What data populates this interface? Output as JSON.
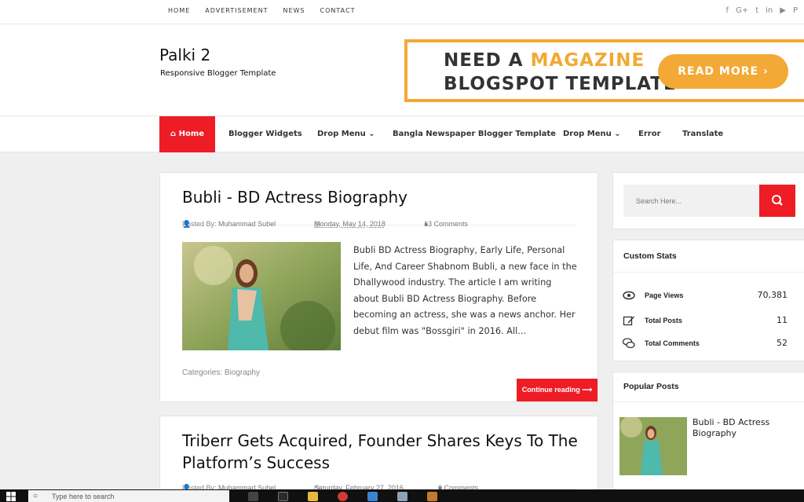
{
  "topnav": [
    "HOME",
    "ADVERTISEMENT",
    "NEWS",
    "CONTACT"
  ],
  "social_icons": [
    "facebook-icon",
    "google-plus-icon",
    "twitter-icon",
    "linkedin-icon",
    "youtube-icon",
    "pinterest-icon"
  ],
  "social_glyphs": [
    "f",
    "G+",
    "t",
    "in",
    "▶",
    "P"
  ],
  "site": {
    "title": "Palki 2",
    "description": "Responsive Blogger Template"
  },
  "banner": {
    "line1_a": "NEED A ",
    "line1_b": "MAGAZINE",
    "line2": "BLOGSPOT TEMPLATE",
    "button": "READ MORE ›"
  },
  "mainnav": [
    "Home",
    "Blogger Widgets",
    "Drop Menu",
    "Bangla Newspaper Blogger Template",
    "Drop Menu",
    "Error",
    "Translate"
  ],
  "posts": [
    {
      "title": "Bubli - BD Actress Biography",
      "author_label": "Posted By:",
      "author": "Muhammad Subel",
      "date": "Monday, May 14, 2018",
      "comments": "13 Comments",
      "excerpt": "Bubli BD Actress Biography, Early Life, Personal Life, And Career Shabnom Bubli, a new face in the Dhallywood industry. The article I am writing about Bubli BD Actress Biography. Before becoming an actress, she was a news anchor. Her debut film was \"Bossgiri\" in 2016. All...",
      "categories_label": "Categories:",
      "category": "Biography",
      "read_more": "Continue reading ⟶"
    },
    {
      "title_line1": "Triberr Gets Acquired, Founder Shares Keys To The",
      "title_line2": "Platform’s Success",
      "author_label": "Posted By:",
      "author": "Muhammad Subel",
      "date": "Saturday, February 27, 2016",
      "comments": "0 Comments"
    }
  ],
  "search": {
    "placeholder": "Search Here..."
  },
  "stats": {
    "title": "Custom Stats",
    "rows": [
      {
        "label": "Page Views",
        "value": "70,381",
        "icon": "eye-icon"
      },
      {
        "label": "Total Posts",
        "value": "11",
        "icon": "edit-icon"
      },
      {
        "label": "Total Comments",
        "value": "52",
        "icon": "comments-icon"
      }
    ]
  },
  "popular": {
    "title": "Popular Posts",
    "items": [
      {
        "title": "Bubli - BD Actress Biography"
      }
    ]
  },
  "taskbar": {
    "search_placeholder": "Type here to search"
  },
  "colors": {
    "accent_red": "#ee1c25",
    "banner_orange": "#f2a935"
  }
}
